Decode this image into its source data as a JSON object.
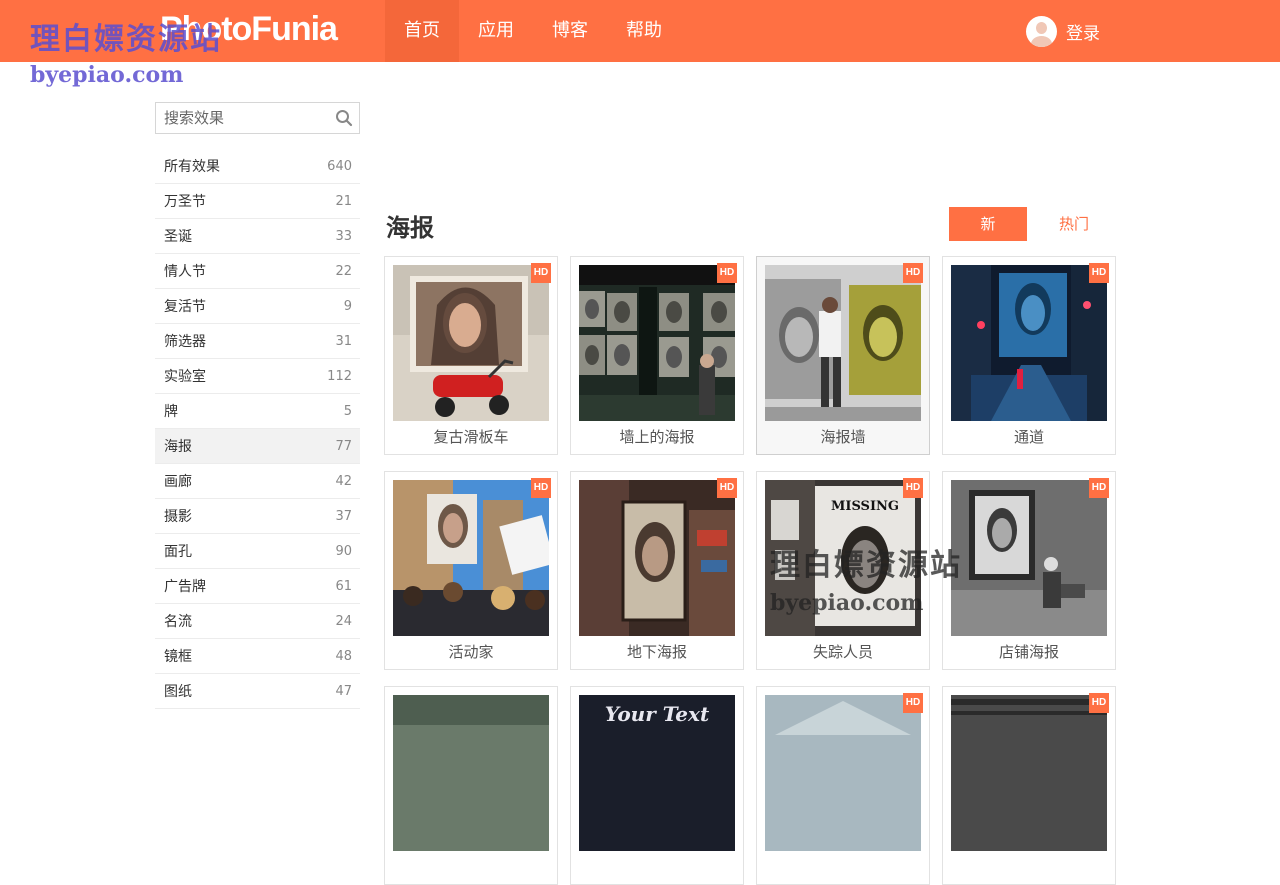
{
  "header": {
    "logo": "PhotoFunia",
    "nav": [
      "首页",
      "应用",
      "博客",
      "帮助"
    ],
    "login_label": "登录"
  },
  "watermark": {
    "title": "理白嫖资源站",
    "url": "byepiao.com"
  },
  "sidebar": {
    "search_placeholder": "搜索效果",
    "categories": [
      {
        "name": "所有效果",
        "count": "640"
      },
      {
        "name": "万圣节",
        "count": "21"
      },
      {
        "name": "圣诞",
        "count": "33"
      },
      {
        "name": "情人节",
        "count": "22"
      },
      {
        "name": "复活节",
        "count": "9"
      },
      {
        "name": "筛选器",
        "count": "31"
      },
      {
        "name": "实验室",
        "count": "112"
      },
      {
        "name": "牌",
        "count": "5"
      },
      {
        "name": "海报",
        "count": "77"
      },
      {
        "name": "画廊",
        "count": "42"
      },
      {
        "name": "摄影",
        "count": "37"
      },
      {
        "name": "面孔",
        "count": "90"
      },
      {
        "name": "广告牌",
        "count": "61"
      },
      {
        "name": "名流",
        "count": "24"
      },
      {
        "name": "镜框",
        "count": "48"
      },
      {
        "name": "图纸",
        "count": "47"
      }
    ],
    "active_category": "海报"
  },
  "main": {
    "title": "海报",
    "sort_new": "新",
    "sort_hot": "热门",
    "hd_badge": "HD",
    "effects": [
      {
        "label": "复古滑板车",
        "icon": "vintage-scooter-poster-thumb"
      },
      {
        "label": "墙上的海报",
        "icon": "posters-on-wall-thumb"
      },
      {
        "label": "海报墙",
        "icon": "poster-wall-thumb"
      },
      {
        "label": "通道",
        "icon": "alley-passage-thumb"
      },
      {
        "label": "活动家",
        "icon": "activist-sign-thumb"
      },
      {
        "label": "地下海报",
        "icon": "underground-poster-thumb"
      },
      {
        "label": "失踪人员",
        "icon": "missing-person-thumb",
        "overlay_text": "MISSING"
      },
      {
        "label": "店铺海报",
        "icon": "shop-poster-thumb"
      },
      {
        "label": "",
        "icon": "row3-thumb-1"
      },
      {
        "label": "",
        "icon": "row3-thumb-2",
        "overlay_text": "Your Text"
      },
      {
        "label": "",
        "icon": "row3-thumb-3"
      },
      {
        "label": "",
        "icon": "row3-thumb-4"
      }
    ],
    "colors": {
      "accent": "#ff7043"
    }
  }
}
